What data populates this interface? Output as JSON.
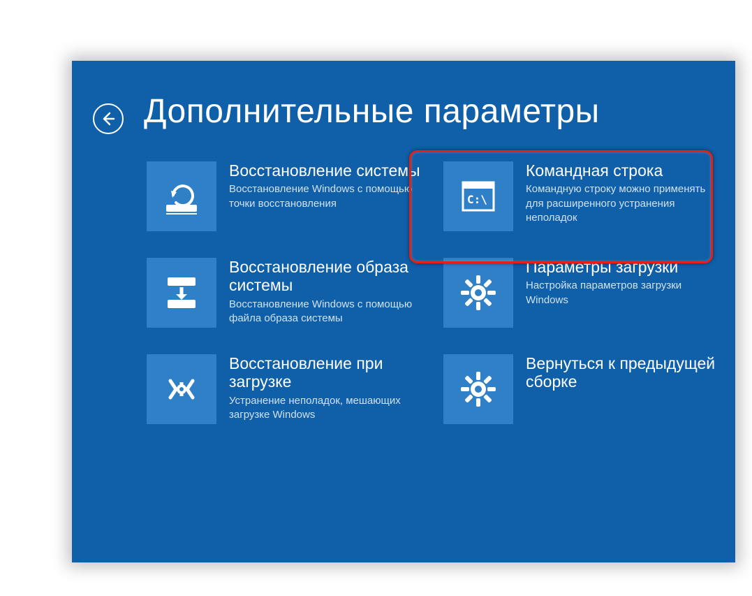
{
  "page_title": "Дополнительные параметры",
  "options": {
    "system_restore": {
      "title": "Восстановление системы",
      "desc": "Восстановление Windows с помощью точки восстановления"
    },
    "image_recovery": {
      "title": "Восстановление образа системы",
      "desc": "Восстановление Windows с помощью файла образа системы"
    },
    "startup_repair": {
      "title": "Восстановление при загрузке",
      "desc": "Устранение неполадок, мешающих загрузке Windows"
    },
    "command_prompt": {
      "title": "Командная строка",
      "desc": "Командную строку можно применять для расширенного устранения неполадок"
    },
    "startup_settings": {
      "title": "Параметры загрузки",
      "desc": "Настройка параметров загрузки Windows"
    },
    "go_back": {
      "title": "Вернуться к предыдущей сборке",
      "desc": ""
    }
  }
}
